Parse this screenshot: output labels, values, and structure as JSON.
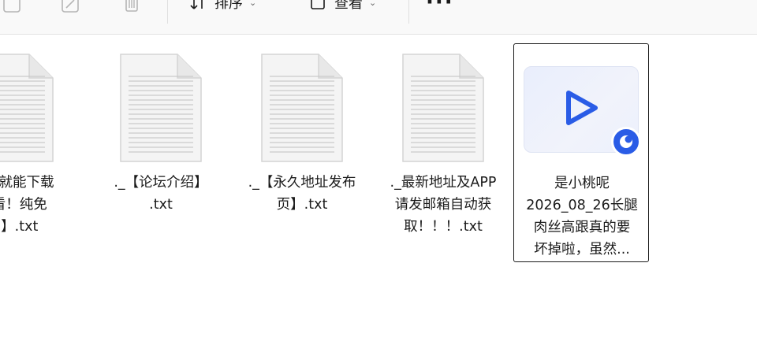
{
  "toolbar": {
    "sort_label": "排序",
    "view_label": "查看",
    "more_label": "···",
    "icons": [
      "share-icon",
      "rename-icon",
      "delete-icon",
      "sort-icon",
      "view-icon",
      "more-icon"
    ]
  },
  "files": [
    {
      "name": "注了就能下载\n观看！纯免\n！】.txt",
      "type": "txt"
    },
    {
      "name": "._【论坛介绍】\n.txt",
      "type": "txt"
    },
    {
      "name": "._【永久地址发布\n页】.txt",
      "type": "txt"
    },
    {
      "name": "._最新地址及APP\n请发邮箱自动获\n取！！！.txt",
      "type": "txt"
    },
    {
      "name": "是小桃呢\n2026_08_26长腿\n肉丝高跟真的要\n坏掉啦，虽然...",
      "type": "video"
    }
  ],
  "colors": {
    "accent": "#2a5ce6",
    "selection_border": "#1a1a1a"
  }
}
